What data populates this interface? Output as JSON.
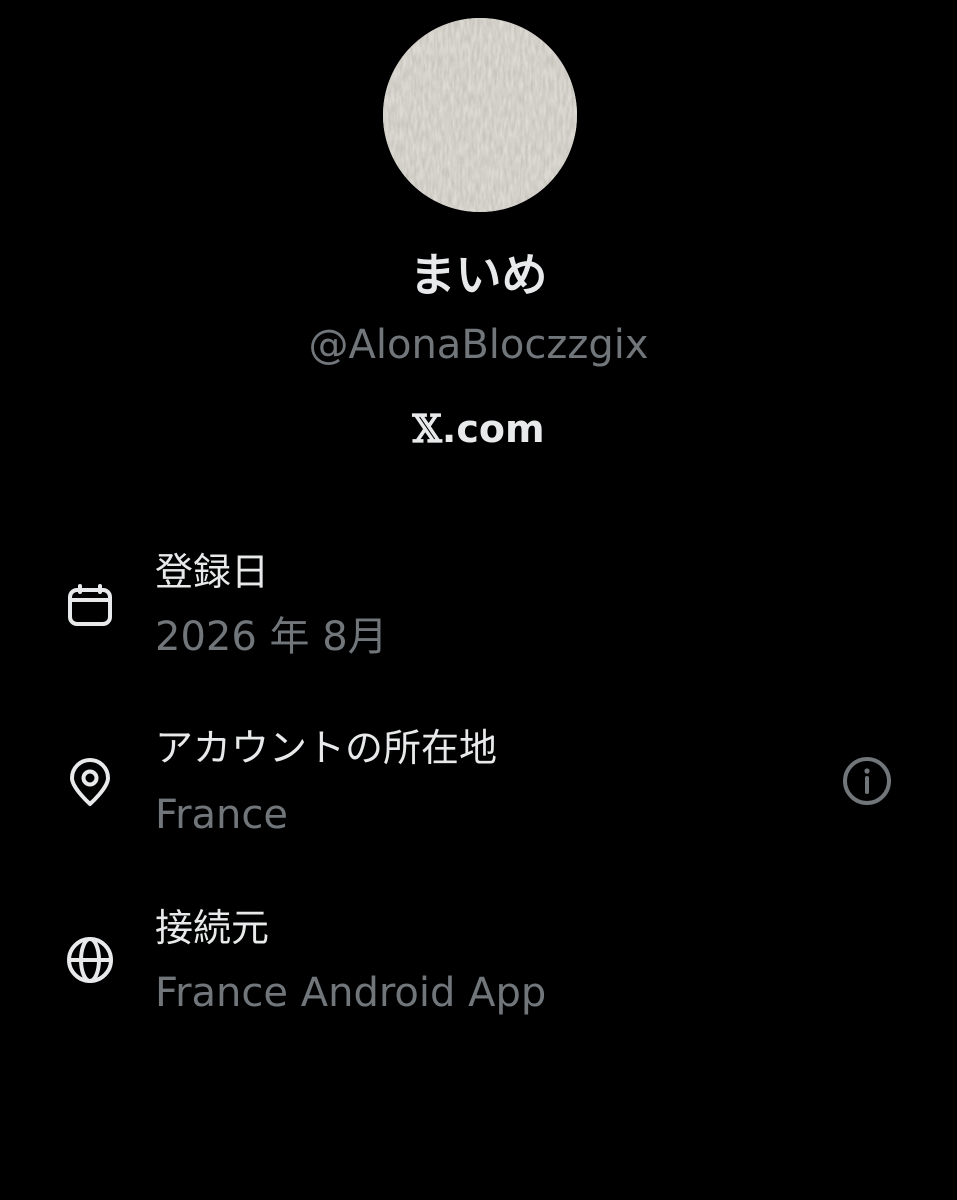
{
  "profile": {
    "display_name": "まいめ",
    "handle": "@AlonaBloczzgix",
    "source_x": "𝕏",
    "source_rest": ".com"
  },
  "about": {
    "joined": {
      "icon": "calendar-icon",
      "title": "登録日",
      "value": "2026 年 8月"
    },
    "location": {
      "icon": "location-pin-icon",
      "title": "アカウントの所在地",
      "value": "France",
      "info_icon": "info-icon"
    },
    "connected_via": {
      "icon": "globe-icon",
      "title": "接続元",
      "value": "France Android App"
    }
  },
  "colors": {
    "background": "#000000",
    "primary_text": "#e7e9ea",
    "secondary_text": "#71767b"
  }
}
